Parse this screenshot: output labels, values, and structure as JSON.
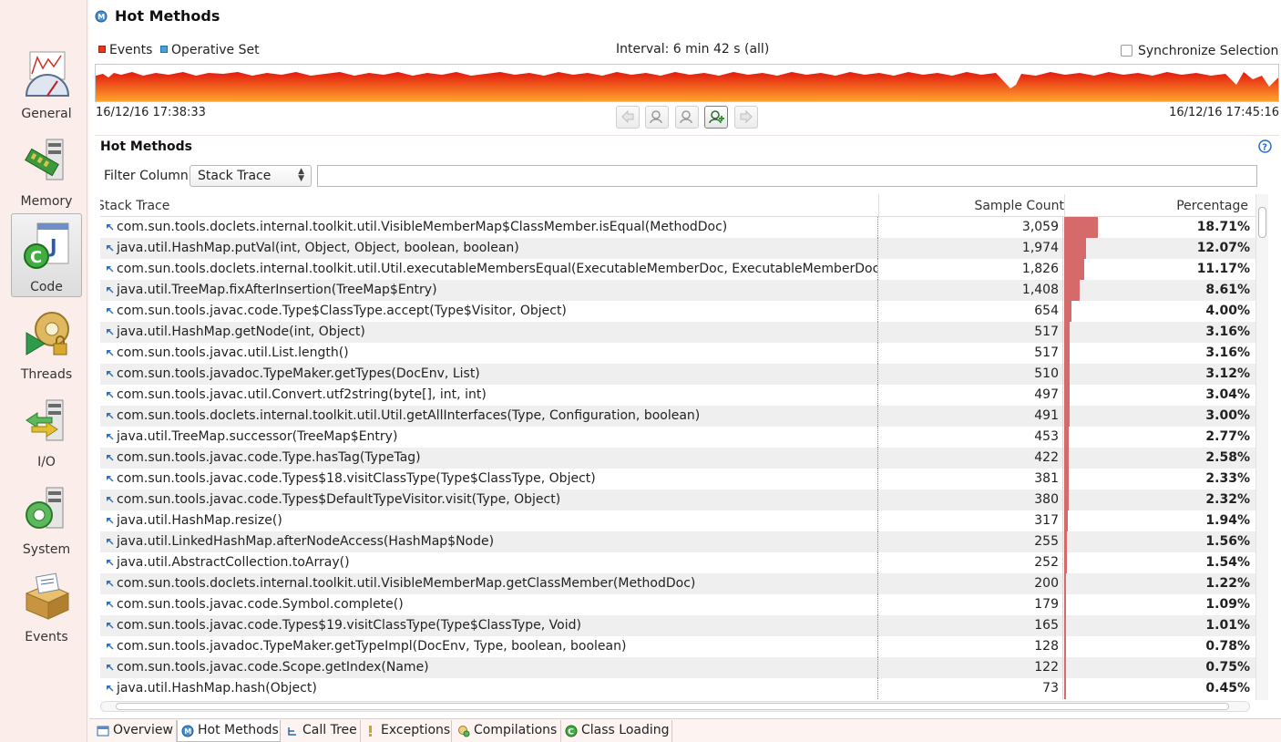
{
  "sidebar": {
    "items": [
      {
        "label": "General",
        "icon": "gauge-icon"
      },
      {
        "label": "Memory",
        "icon": "memory-icon"
      },
      {
        "label": "Code",
        "icon": "code-icon",
        "active": true
      },
      {
        "label": "Threads",
        "icon": "threads-icon"
      },
      {
        "label": "I/O",
        "icon": "io-icon"
      },
      {
        "label": "System",
        "icon": "system-icon"
      },
      {
        "label": "Events",
        "icon": "events-icon"
      }
    ]
  },
  "header": {
    "title": "Hot Methods"
  },
  "range": {
    "legend_events": "Events",
    "legend_opset": "Operative Set",
    "interval": "Interval: 6 min 42 s (all)",
    "sync_label": "Synchronize Selection",
    "start_time": "16/12/16 17:38:33",
    "end_time": "16/12/16 17:45:16",
    "events_color": "#e8381a",
    "opset_color": "#4aa0d8"
  },
  "section": {
    "title": "Hot Methods",
    "filter_label": "Filter Column",
    "filter_value": "Stack Trace",
    "filter_text": ""
  },
  "table": {
    "columns": {
      "trace": "Stack Trace",
      "count": "Sample Count",
      "percentage": "Percentage"
    },
    "rows": [
      {
        "trace": "com.sun.tools.doclets.internal.toolkit.util.VisibleMemberMap$ClassMember.isEqual(MethodDoc)",
        "count": "3,059",
        "pct": "18.71%",
        "pct_value": 18.71
      },
      {
        "trace": "java.util.HashMap.putVal(int, Object, Object, boolean, boolean)",
        "count": "1,974",
        "pct": "12.07%",
        "pct_value": 12.07
      },
      {
        "trace": "com.sun.tools.doclets.internal.toolkit.util.Util.executableMembersEqual(ExecutableMemberDoc, ExecutableMemberDoc)",
        "count": "1,826",
        "pct": "11.17%",
        "pct_value": 11.17
      },
      {
        "trace": "java.util.TreeMap.fixAfterInsertion(TreeMap$Entry)",
        "count": "1,408",
        "pct": "8.61%",
        "pct_value": 8.61
      },
      {
        "trace": "com.sun.tools.javac.code.Type$ClassType.accept(Type$Visitor, Object)",
        "count": "654",
        "pct": "4.00%",
        "pct_value": 4.0
      },
      {
        "trace": "java.util.HashMap.getNode(int, Object)",
        "count": "517",
        "pct": "3.16%",
        "pct_value": 3.16
      },
      {
        "trace": "com.sun.tools.javac.util.List.length()",
        "count": "517",
        "pct": "3.16%",
        "pct_value": 3.16
      },
      {
        "trace": "com.sun.tools.javadoc.TypeMaker.getTypes(DocEnv, List)",
        "count": "510",
        "pct": "3.12%",
        "pct_value": 3.12
      },
      {
        "trace": "com.sun.tools.javac.util.Convert.utf2string(byte[], int, int)",
        "count": "497",
        "pct": "3.04%",
        "pct_value": 3.04
      },
      {
        "trace": "com.sun.tools.doclets.internal.toolkit.util.Util.getAllInterfaces(Type, Configuration, boolean)",
        "count": "491",
        "pct": "3.00%",
        "pct_value": 3.0
      },
      {
        "trace": "java.util.TreeMap.successor(TreeMap$Entry)",
        "count": "453",
        "pct": "2.77%",
        "pct_value": 2.77
      },
      {
        "trace": "com.sun.tools.javac.code.Type.hasTag(TypeTag)",
        "count": "422",
        "pct": "2.58%",
        "pct_value": 2.58
      },
      {
        "trace": "com.sun.tools.javac.code.Types$18.visitClassType(Type$ClassType, Object)",
        "count": "381",
        "pct": "2.33%",
        "pct_value": 2.33
      },
      {
        "trace": "com.sun.tools.javac.code.Types$DefaultTypeVisitor.visit(Type, Object)",
        "count": "380",
        "pct": "2.32%",
        "pct_value": 2.32
      },
      {
        "trace": "java.util.HashMap.resize()",
        "count": "317",
        "pct": "1.94%",
        "pct_value": 1.94
      },
      {
        "trace": "java.util.LinkedHashMap.afterNodeAccess(HashMap$Node)",
        "count": "255",
        "pct": "1.56%",
        "pct_value": 1.56
      },
      {
        "trace": "java.util.AbstractCollection.toArray()",
        "count": "252",
        "pct": "1.54%",
        "pct_value": 1.54
      },
      {
        "trace": "com.sun.tools.doclets.internal.toolkit.util.VisibleMemberMap.getClassMember(MethodDoc)",
        "count": "200",
        "pct": "1.22%",
        "pct_value": 1.22
      },
      {
        "trace": "com.sun.tools.javac.code.Symbol.complete()",
        "count": "179",
        "pct": "1.09%",
        "pct_value": 1.09
      },
      {
        "trace": "com.sun.tools.javac.code.Types$19.visitClassType(Type$ClassType, Void)",
        "count": "165",
        "pct": "1.01%",
        "pct_value": 1.01
      },
      {
        "trace": "com.sun.tools.javadoc.TypeMaker.getTypeImpl(DocEnv, Type, boolean, boolean)",
        "count": "128",
        "pct": "0.78%",
        "pct_value": 0.78
      },
      {
        "trace": "com.sun.tools.javac.code.Scope.getIndex(Name)",
        "count": "122",
        "pct": "0.75%",
        "pct_value": 0.75
      },
      {
        "trace": "java.util.HashMap.hash(Object)",
        "count": "73",
        "pct": "0.45%",
        "pct_value": 0.45
      }
    ]
  },
  "tabs": [
    {
      "label": "Overview",
      "icon": "overview-icon"
    },
    {
      "label": "Hot Methods",
      "icon": "hot-methods-icon",
      "active": true
    },
    {
      "label": "Call Tree",
      "icon": "call-tree-icon"
    },
    {
      "label": "Exceptions",
      "icon": "exceptions-icon"
    },
    {
      "label": "Compilations",
      "icon": "compilations-icon"
    },
    {
      "label": "Class Loading",
      "icon": "class-loading-icon"
    }
  ]
}
